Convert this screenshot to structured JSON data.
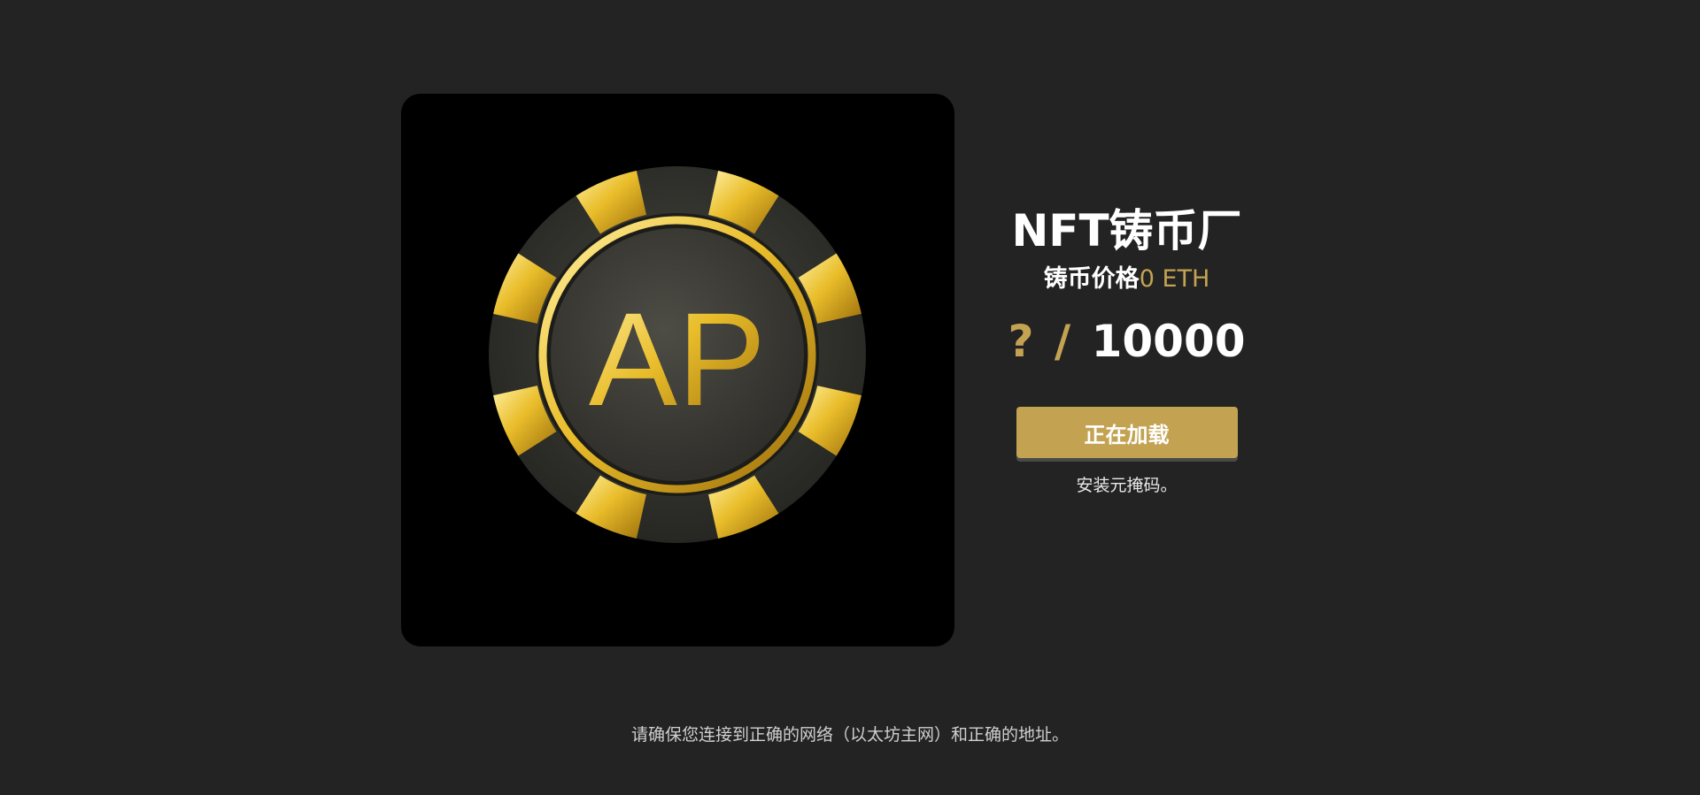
{
  "app": {
    "title": "NFT铸币厂"
  },
  "mint": {
    "price_label": "铸币价格",
    "price_value": "0 ETH",
    "minted_count": "?",
    "separator": "/",
    "total_supply": "10000",
    "button_label": "正在加载",
    "install_note": "安装元掩码。"
  },
  "nft_image": {
    "logo_text": "AP",
    "icon": "poker-chip-icon"
  },
  "footer": {
    "note": "请确保您连接到正确的网络（以太坊主网）和正确的地址。"
  },
  "colors": {
    "background": "#232323",
    "accent_gold": "#c3a352",
    "card_background": "#000000",
    "text": "#ffffff"
  }
}
